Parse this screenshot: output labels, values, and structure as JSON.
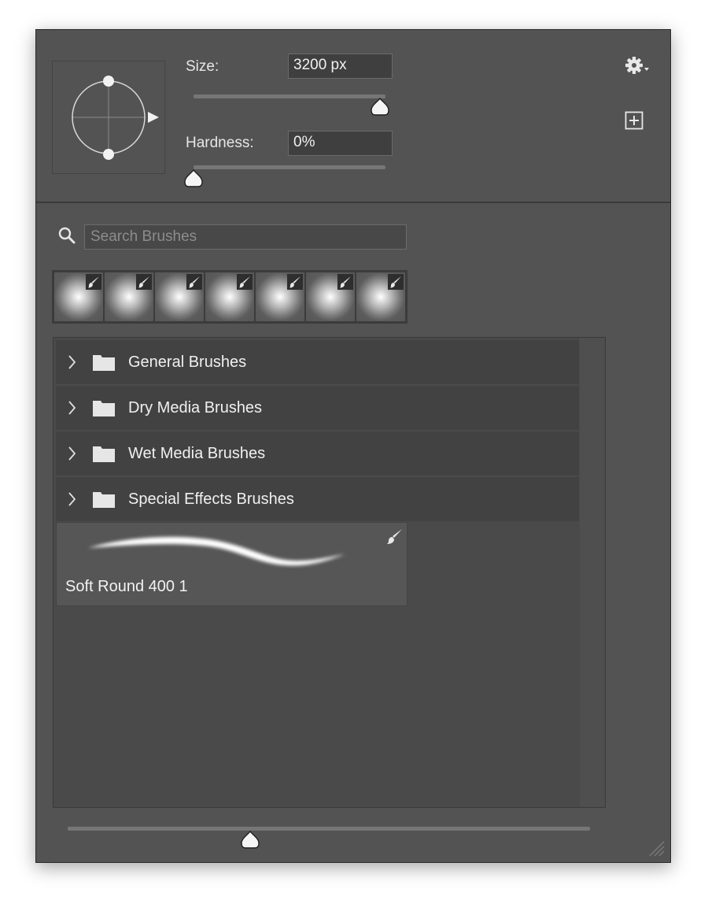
{
  "brush_settings": {
    "size_label": "Size:",
    "size_value": "3200 px",
    "size_fraction": 0.97,
    "hardness_label": "Hardness:",
    "hardness_value": "0%",
    "hardness_fraction": 0.0
  },
  "header_icons": {
    "settings": "gear-icon",
    "new_preset": "add-square-icon"
  },
  "search": {
    "placeholder": "Search Brushes",
    "value": ""
  },
  "recent_brushes": [
    {
      "icon": "soft-round-brush"
    },
    {
      "icon": "soft-round-brush"
    },
    {
      "icon": "soft-round-brush"
    },
    {
      "icon": "soft-round-brush"
    },
    {
      "icon": "soft-round-brush"
    },
    {
      "icon": "soft-round-brush"
    },
    {
      "icon": "soft-round-brush"
    }
  ],
  "folders": [
    {
      "label": "General Brushes"
    },
    {
      "label": "Dry Media Brushes"
    },
    {
      "label": "Wet Media Brushes"
    },
    {
      "label": "Special Effects Brushes"
    }
  ],
  "brush_preset": {
    "name": "Soft Round 400 1"
  },
  "preview_size_fraction": 0.35,
  "colors": {
    "panel": "#535353",
    "list_bg": "#4a4a4a",
    "folder_row": "#424242",
    "text": "#f0f0f0"
  }
}
